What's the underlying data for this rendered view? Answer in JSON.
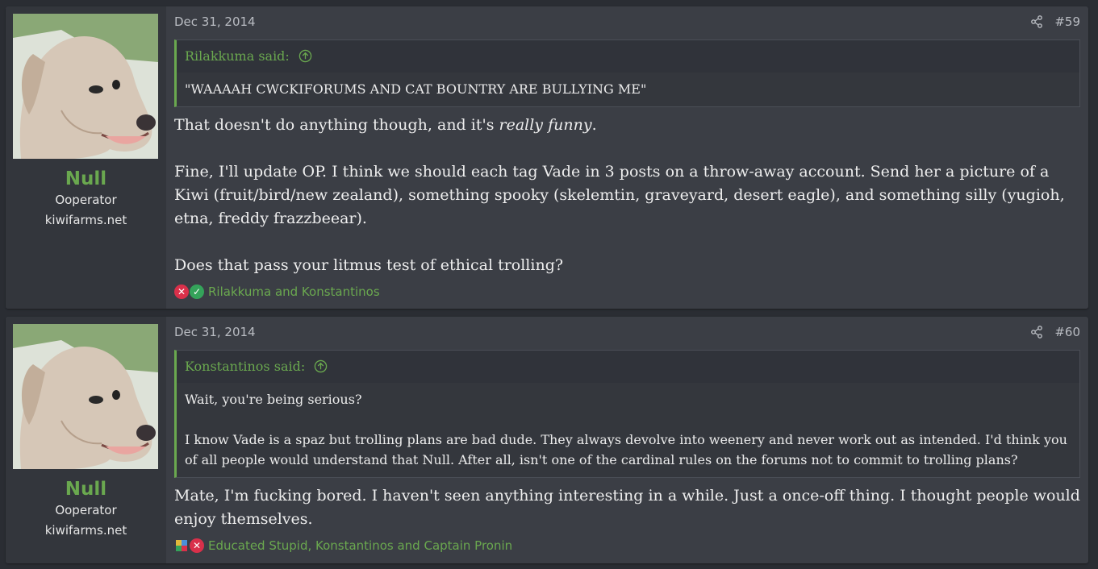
{
  "colors": {
    "accent": "#6aa84f",
    "post_background": "#3b3e45",
    "user_cell_background": "#33363c",
    "text": "#eeeeee",
    "reaction_negative": "#d9304a",
    "reaction_positive": "#34a35a"
  },
  "posts": [
    {
      "user": {
        "avatar_icon": "dog-avatar",
        "name": "Null",
        "title": "Ooperator",
        "banner": "kiwifarms.net"
      },
      "date": "Dec 31, 2014",
      "share_icon": "share-icon",
      "number": "#59",
      "quote": {
        "author": "Rilakkuma said:",
        "arrow_icon": "arrow-up-circle-icon",
        "paragraphs": [
          "\"WAAAAH CWCKIFORUMS AND CAT BOUNTRY ARE BULLYING ME\""
        ]
      },
      "message": {
        "p1_before": "That doesn't do anything though, and it's ",
        "p1_italic": "really funny",
        "p1_after": ".",
        "p2": "Fine, I'll update OP. I think we should each tag Vade in 3 posts on a throw-away account. Send her a picture of a Kiwi (fruit/bird/new zealand), something spooky (skelemtin, graveyard, desert eagle), and something silly (yugioh, etna, freddy frazzbeear).",
        "p3": "Does that pass your litmus test of ethical trolling?"
      },
      "reactions": {
        "icons": [
          "x-icon",
          "check-icon"
        ],
        "text": "Rilakkuma and Konstantinos"
      }
    },
    {
      "user": {
        "avatar_icon": "dog-avatar",
        "name": "Null",
        "title": "Ooperator",
        "banner": "kiwifarms.net"
      },
      "date": "Dec 31, 2014",
      "share_icon": "share-icon",
      "number": "#60",
      "quote": {
        "author": "Konstantinos said:",
        "arrow_icon": "arrow-up-circle-icon",
        "paragraphs": [
          "Wait, you're being serious?",
          "I know Vade is a spaz but trolling plans are bad dude. They always devolve into weenery and never work out as intended. I'd think you of all people would understand that Null. After all, isn't one of the cardinal rules on the forums not to commit to trolling plans?"
        ]
      },
      "message": {
        "p1": "Mate, I'm fucking bored. I haven't seen anything interesting in a while. Just a once-off thing. I thought people would enjoy themselves."
      },
      "reactions": {
        "icons": [
          "puzzle-icon",
          "x-icon"
        ],
        "text": "Educated Stupid, Konstantinos and Captain Pronin"
      }
    }
  ]
}
